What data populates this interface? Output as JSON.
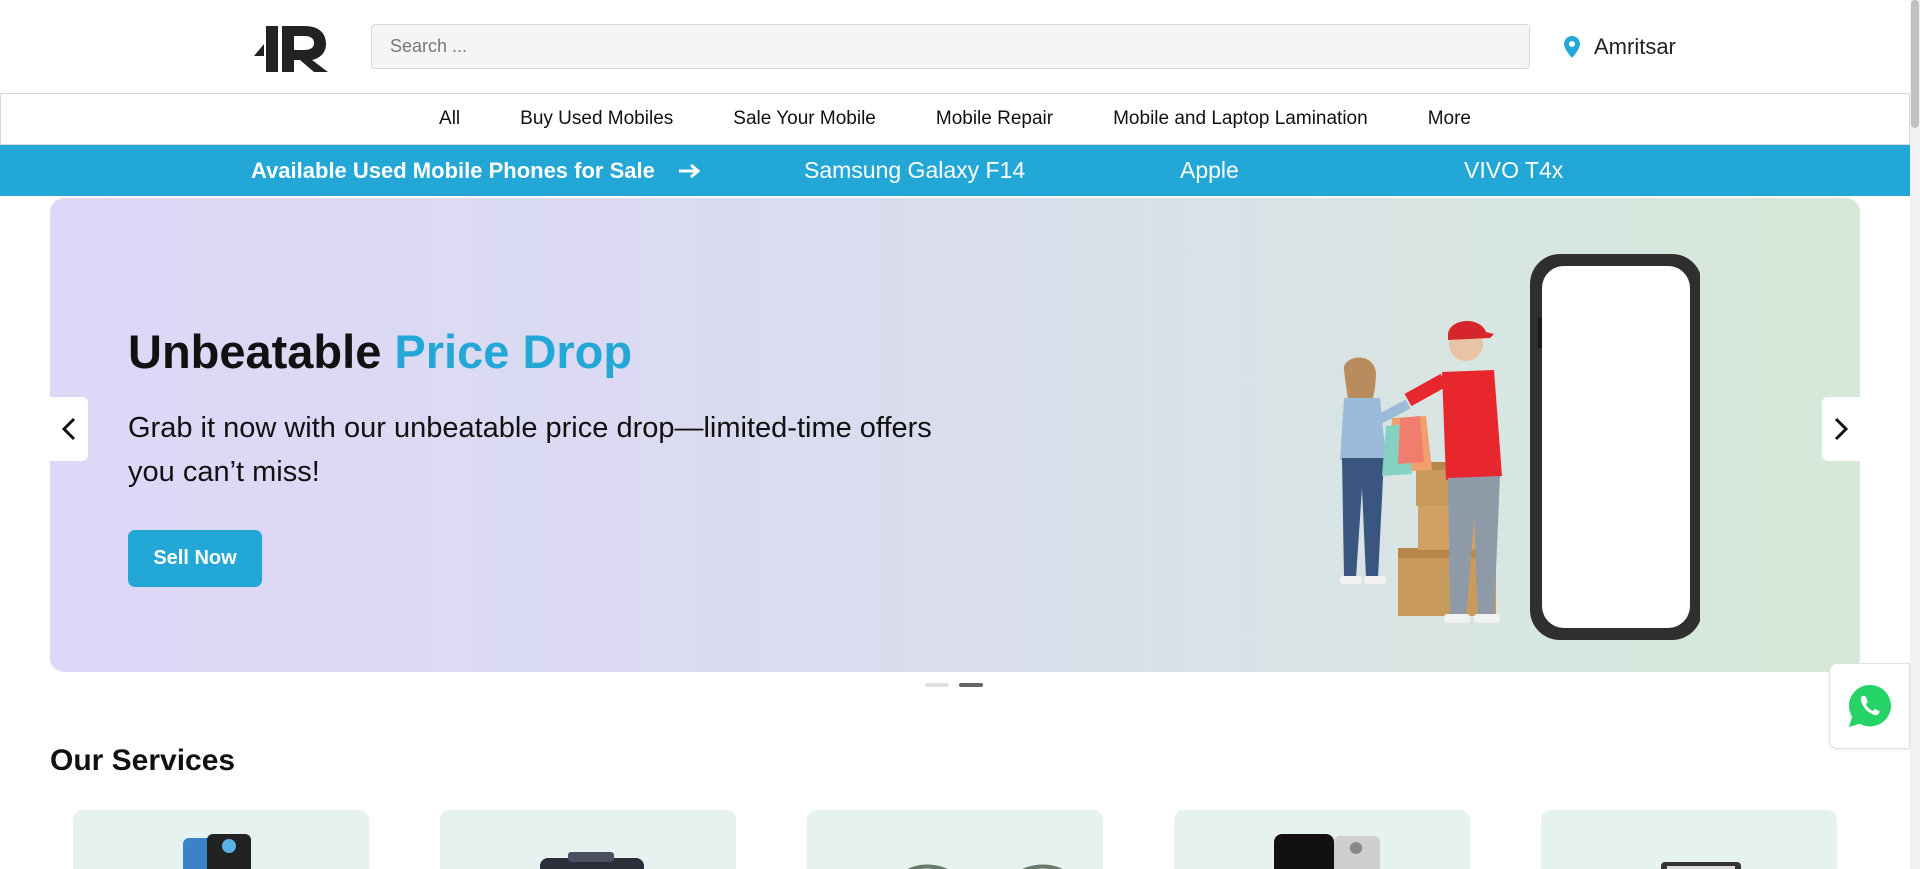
{
  "header": {
    "search_placeholder": "Search ...",
    "location": "Amritsar"
  },
  "categories": [
    "All",
    "Buy Used Mobiles",
    "Sale Your Mobile",
    "Mobile Repair",
    "Mobile and Laptop Lamination",
    "More"
  ],
  "strip": {
    "headline": "Available Used Mobile Phones for Sale",
    "models": [
      "Samsung Galaxy F14",
      "Apple",
      "VIVO T4x"
    ]
  },
  "hero": {
    "title_main": "Unbeatable",
    "title_accent": "Price Drop",
    "subtitle": "Grab it now with our unbeatable price drop—limited-time offers you can’t miss!",
    "button": "Sell Now",
    "slide_count": 2,
    "active_slide": 2
  },
  "services": {
    "title": "Our Services"
  },
  "colors": {
    "accent": "#22a7d6",
    "whatsapp": "#25d366",
    "service_card": "#e6f2f0"
  },
  "icons": {
    "location": "map-pin-icon",
    "prev": "chevron-left-icon",
    "next": "chevron-right-icon",
    "arrow": "arrow-right-icon",
    "whatsapp": "whatsapp-icon"
  }
}
